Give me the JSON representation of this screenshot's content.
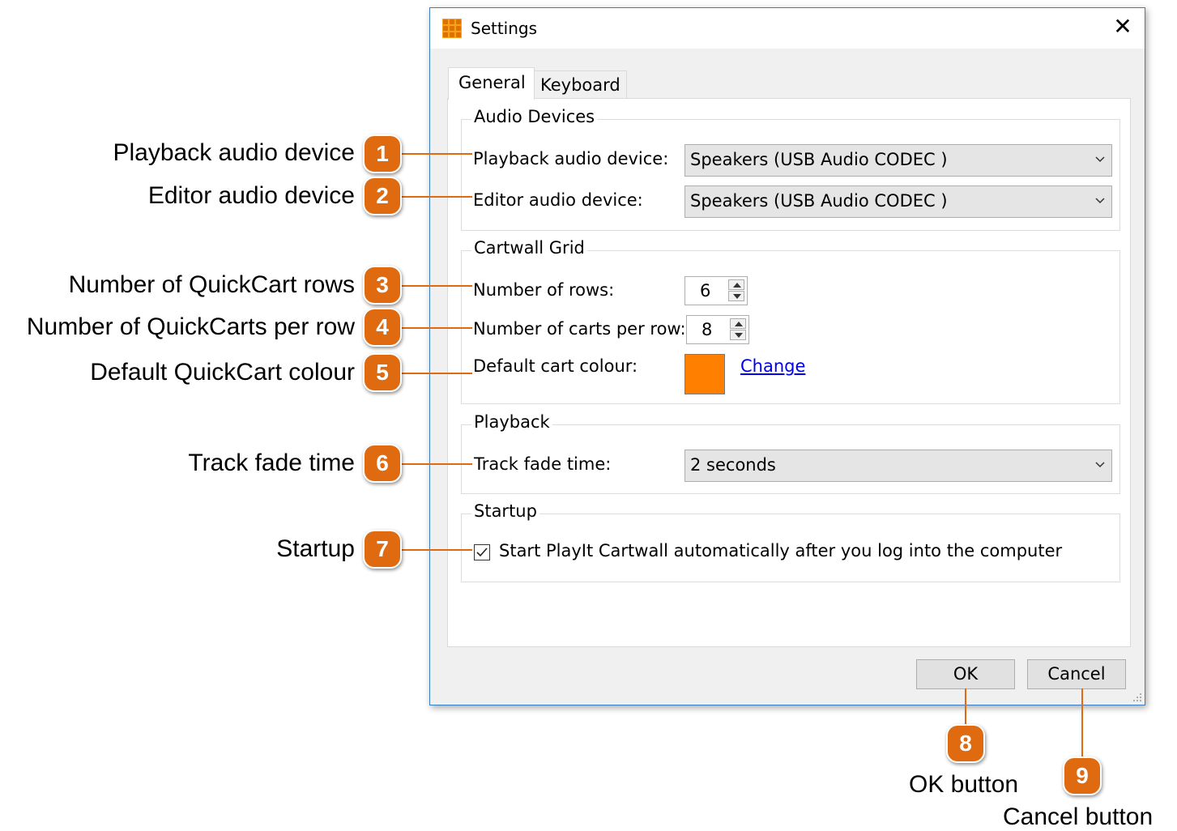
{
  "window": {
    "title": "Settings",
    "close_glyph": "✕",
    "app_icon": "cartwall-grid-icon"
  },
  "tabs": [
    {
      "label": "General",
      "selected": true
    },
    {
      "label": "Keyboard",
      "selected": false
    }
  ],
  "audio_devices": {
    "group_title": "Audio Devices",
    "playback_label": "Playback audio device:",
    "playback_value": "Speakers (USB Audio CODEC )",
    "editor_label": "Editor audio device:",
    "editor_value": "Speakers (USB Audio CODEC )"
  },
  "cartwall_grid": {
    "group_title": "Cartwall Grid",
    "rows_label": "Number of rows:",
    "rows_value": "6",
    "carts_label": "Number of carts per row:",
    "carts_value": "8",
    "colour_label": "Default cart colour:",
    "colour_value": "#ff7f00",
    "change_link": "Change"
  },
  "playback": {
    "group_title": "Playback",
    "fade_label": "Track fade time:",
    "fade_value": "2 seconds"
  },
  "startup": {
    "group_title": "Startup",
    "checkbox_label": "Start PlayIt Cartwall automatically after you log into the computer",
    "checked": true
  },
  "buttons": {
    "ok": "OK",
    "cancel": "Cancel"
  },
  "callouts": [
    {
      "number": "1",
      "text": "Playback audio device"
    },
    {
      "number": "2",
      "text": "Editor audio device"
    },
    {
      "number": "3",
      "text": "Number of QuickCart rows"
    },
    {
      "number": "4",
      "text": "Number of QuickCarts per row"
    },
    {
      "number": "5",
      "text": "Default QuickCart colour"
    },
    {
      "number": "6",
      "text": "Track fade time"
    },
    {
      "number": "7",
      "text": "Startup"
    },
    {
      "number": "8",
      "text": "OK button"
    },
    {
      "number": "9",
      "text": "Cancel button"
    }
  ],
  "colors": {
    "badge": "#e06a0f",
    "window_border": "#3c7fc0"
  }
}
